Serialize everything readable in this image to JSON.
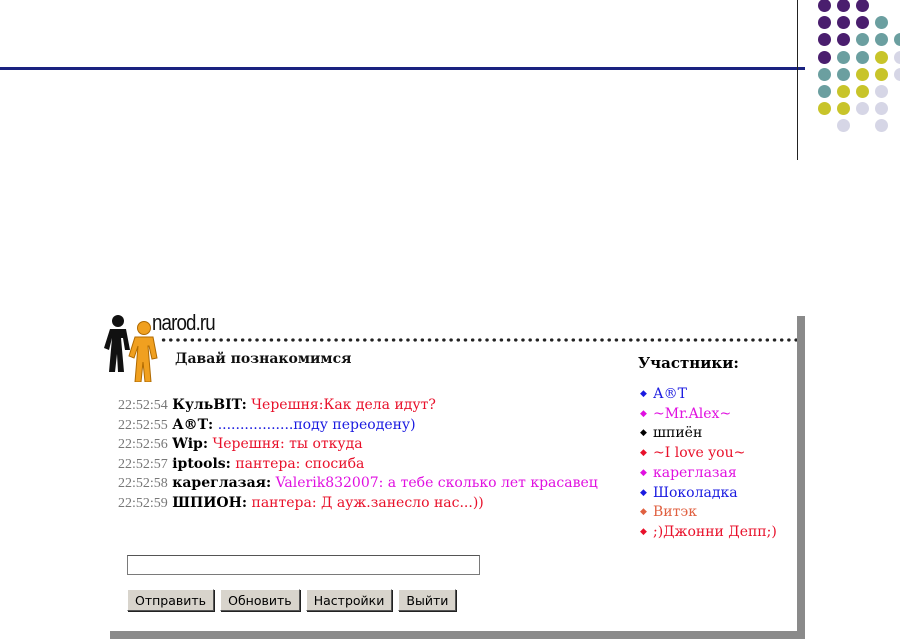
{
  "chat": {
    "logo_text": "narod.ru",
    "title": "Давай познакомимся",
    "users_title": "Участники:",
    "messages": [
      {
        "time": "22:52:54",
        "nick": "КульBIT:",
        "text": "Черешня:Как дела идут?",
        "color": "#e8102a"
      },
      {
        "time": "22:52:55",
        "nick": "А®Т:",
        "text": ".................поду переодену)",
        "color": "#1a1ae0"
      },
      {
        "time": "22:52:56",
        "nick": "Wip:",
        "text": "Черешня: ты откуда",
        "color": "#e8102a"
      },
      {
        "time": "22:52:57",
        "nick": "iptools:",
        "text": "пантера: спосиба",
        "color": "#e8102a"
      },
      {
        "time": "22:52:58",
        "nick": "кареглазая:",
        "text": "Valerik832007: а тебе сколько лет красавец",
        "color": "#e010e0"
      },
      {
        "time": "22:52:59",
        "nick": "ШПИОН:",
        "text": "пантера: Д ауж.занесло нас...))",
        "color": "#e8102a"
      }
    ],
    "users": [
      {
        "name": "А®Т",
        "color": "#1a1ae0"
      },
      {
        "name": "~Mr.Alex~",
        "color": "#e010e0"
      },
      {
        "name": "шпиён",
        "color": "#000000"
      },
      {
        "name": "~I love you~",
        "color": "#e8102a"
      },
      {
        "name": "кареглазая",
        "color": "#e010e0"
      },
      {
        "name": "Шоколадка",
        "color": "#1a1ae0"
      },
      {
        "name": "Витэк",
        "color": "#e06040"
      },
      {
        "name": ";)Джонни Депп;)",
        "color": "#e8102a"
      }
    ],
    "input_value": "",
    "buttons": {
      "send": "Отправить",
      "refresh": "Обновить",
      "settings": "Настройки",
      "exit": "Выйти"
    }
  },
  "decor_colors": {
    "line": "#1a2280",
    "purple": "#4a1e6e",
    "teal": "#6b9fa0",
    "olive": "#c8c42a",
    "lavender": "#d6d6e6"
  }
}
